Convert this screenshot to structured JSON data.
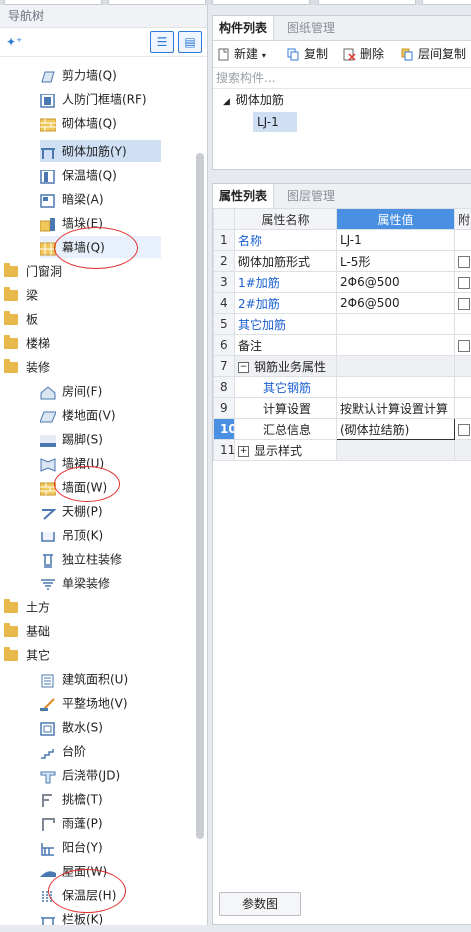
{
  "nav": {
    "title": "导航树",
    "leaves_wall": [
      {
        "label": "剪力墙(Q)",
        "icon": "shear-wall-icon"
      },
      {
        "label": "人防门框墙(RF)",
        "icon": "civil-defense-door-wall-icon"
      },
      {
        "label": "砌体墙(Q)",
        "icon": "masonry-wall-icon"
      },
      {
        "label": "砌体加筋(Y)",
        "icon": "masonry-reinforcement-icon"
      },
      {
        "label": "保温墙(Q)",
        "icon": "insulation-wall-icon"
      },
      {
        "label": "暗梁(A)",
        "icon": "hidden-beam-icon"
      },
      {
        "label": "墙垛(E)",
        "icon": "wall-pier-icon"
      },
      {
        "label": "幕墙(Q)",
        "icon": "curtain-wall-icon"
      }
    ],
    "categories_a": [
      "门窗洞",
      "梁",
      "板",
      "楼梯",
      "装修"
    ],
    "leaves_decor": [
      {
        "label": "房间(F)",
        "icon": "room-icon"
      },
      {
        "label": "楼地面(V)",
        "icon": "floor-icon"
      },
      {
        "label": "踢脚(S)",
        "icon": "skirting-icon"
      },
      {
        "label": "墙裙(U)",
        "icon": "dado-icon"
      },
      {
        "label": "墙面(W)",
        "icon": "wall-surface-icon"
      },
      {
        "label": "天棚(P)",
        "icon": "ceiling-icon"
      },
      {
        "label": "吊顶(K)",
        "icon": "suspended-ceiling-icon"
      },
      {
        "label": "独立柱装修",
        "icon": "column-finish-icon"
      },
      {
        "label": "单梁装修",
        "icon": "beam-finish-icon"
      }
    ],
    "categories_b": [
      "土方",
      "基础",
      "其它"
    ],
    "leaves_other": [
      {
        "label": "建筑面积(U)",
        "icon": "building-area-icon"
      },
      {
        "label": "平整场地(V)",
        "icon": "site-leveling-icon"
      },
      {
        "label": "散水(S)",
        "icon": "apron-icon"
      },
      {
        "label": "台阶",
        "icon": "steps-icon"
      },
      {
        "label": "后浇带(JD)",
        "icon": "post-cast-strip-icon"
      },
      {
        "label": "挑檐(T)",
        "icon": "cornice-icon"
      },
      {
        "label": "雨蓬(P)",
        "icon": "canopy-icon"
      },
      {
        "label": "阳台(Y)",
        "icon": "balcony-icon"
      },
      {
        "label": "屋面(W)",
        "icon": "roof-icon"
      },
      {
        "label": "保温层(H)",
        "icon": "insulation-layer-icon"
      },
      {
        "label": "栏板(K)",
        "icon": "parapet-icon"
      }
    ]
  },
  "components": {
    "tabs": [
      "构件列表",
      "图纸管理"
    ],
    "toolbar": {
      "new": "新建",
      "copy": "复制",
      "delete": "删除",
      "floor_copy": "层间复制"
    },
    "search_placeholder": "搜索构件...",
    "group": "砌体加筋",
    "item": "LJ-1"
  },
  "properties": {
    "tabs": [
      "属性列表",
      "图层管理"
    ],
    "headers": {
      "name": "属性名称",
      "value": "属性值",
      "extra": "附"
    },
    "rows": [
      {
        "n": "1",
        "name": "名称",
        "value": "LJ-1"
      },
      {
        "n": "2",
        "name": "砌体加筋形式",
        "value": "L-5形"
      },
      {
        "n": "3",
        "name": "1#加筋",
        "value": "2Φ6@500"
      },
      {
        "n": "4",
        "name": "2#加筋",
        "value": "2Φ6@500"
      },
      {
        "n": "5",
        "name": "其它加筋",
        "value": ""
      },
      {
        "n": "6",
        "name": "备注",
        "value": ""
      },
      {
        "n": "7",
        "name": "钢筋业务属性",
        "value": ""
      },
      {
        "n": "8",
        "name": "其它钢筋",
        "value": ""
      },
      {
        "n": "9",
        "name": "计算设置",
        "value": "按默认计算设置计算"
      },
      {
        "n": "10",
        "name": "汇总信息",
        "value": "(砌体拉结筋)"
      },
      {
        "n": "11",
        "name": "显示样式",
        "value": ""
      }
    ],
    "param_button": "参数图"
  },
  "colors": {
    "accent": "#4a90e2",
    "link": "#1a5fd0",
    "selection": "#cfe0f5",
    "annotation": "#e0302f",
    "folder": "#e8b84a"
  }
}
